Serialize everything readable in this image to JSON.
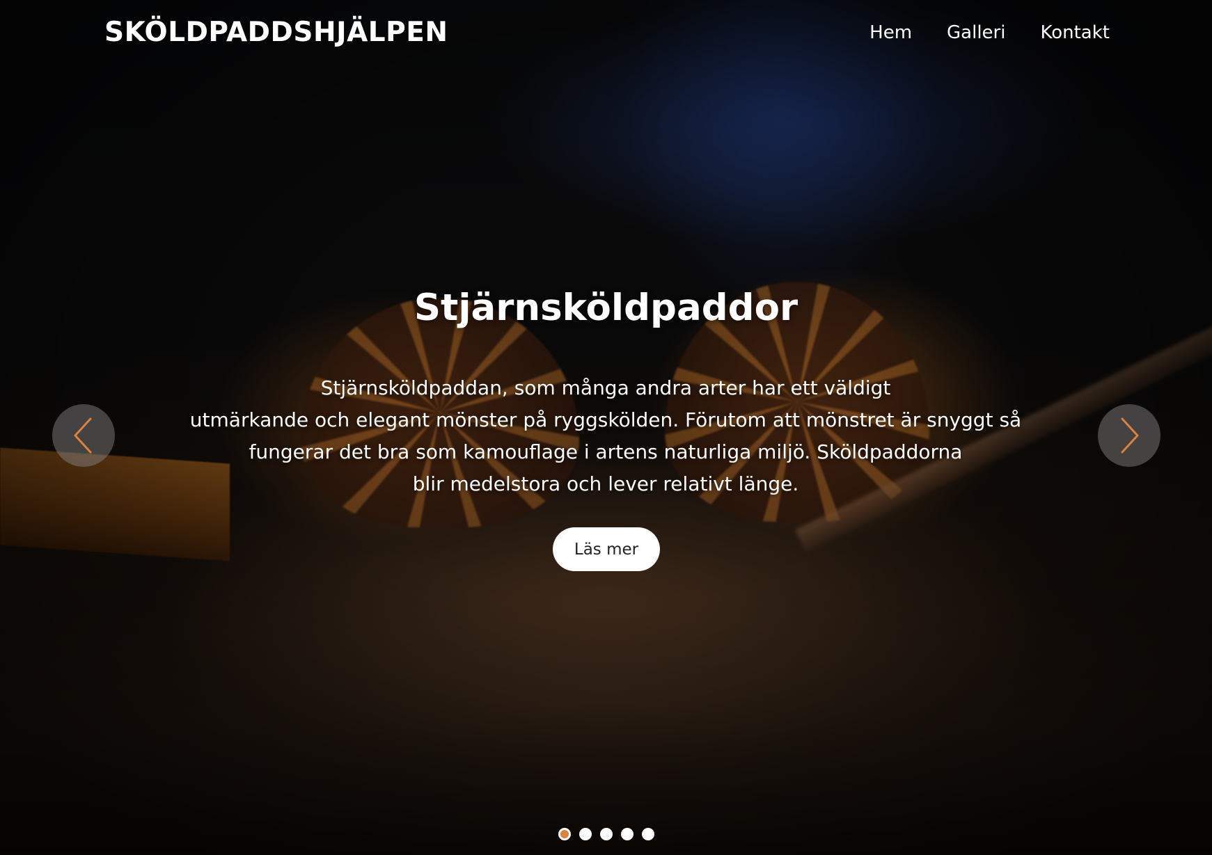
{
  "header": {
    "logo": "SKÖLDPADDSHJÄLPEN",
    "nav": [
      {
        "label": "Hem"
      },
      {
        "label": "Galleri"
      },
      {
        "label": "Kontakt"
      }
    ]
  },
  "slide": {
    "title": "Stjärnsköldpaddor",
    "text_lines": [
      "Stjärnsköldpaddan, som många andra arter har ett väldigt",
      "utmärkande och elegant mönster på ryggskölden. Förutom att mönstret är snyggt så",
      "fungerar det bra som kamouflage i artens naturliga miljö. Sköldpaddorna",
      "blir medelstora och lever relativt länge."
    ],
    "button_label": "Läs mer"
  },
  "carousel": {
    "prev_icon": "chevron-left-icon",
    "next_icon": "chevron-right-icon",
    "slide_count": 5,
    "active_index": 0
  },
  "colors": {
    "accent": "#e0813a",
    "text": "#ffffff",
    "button_bg": "#ffffff",
    "button_text": "#222222"
  }
}
